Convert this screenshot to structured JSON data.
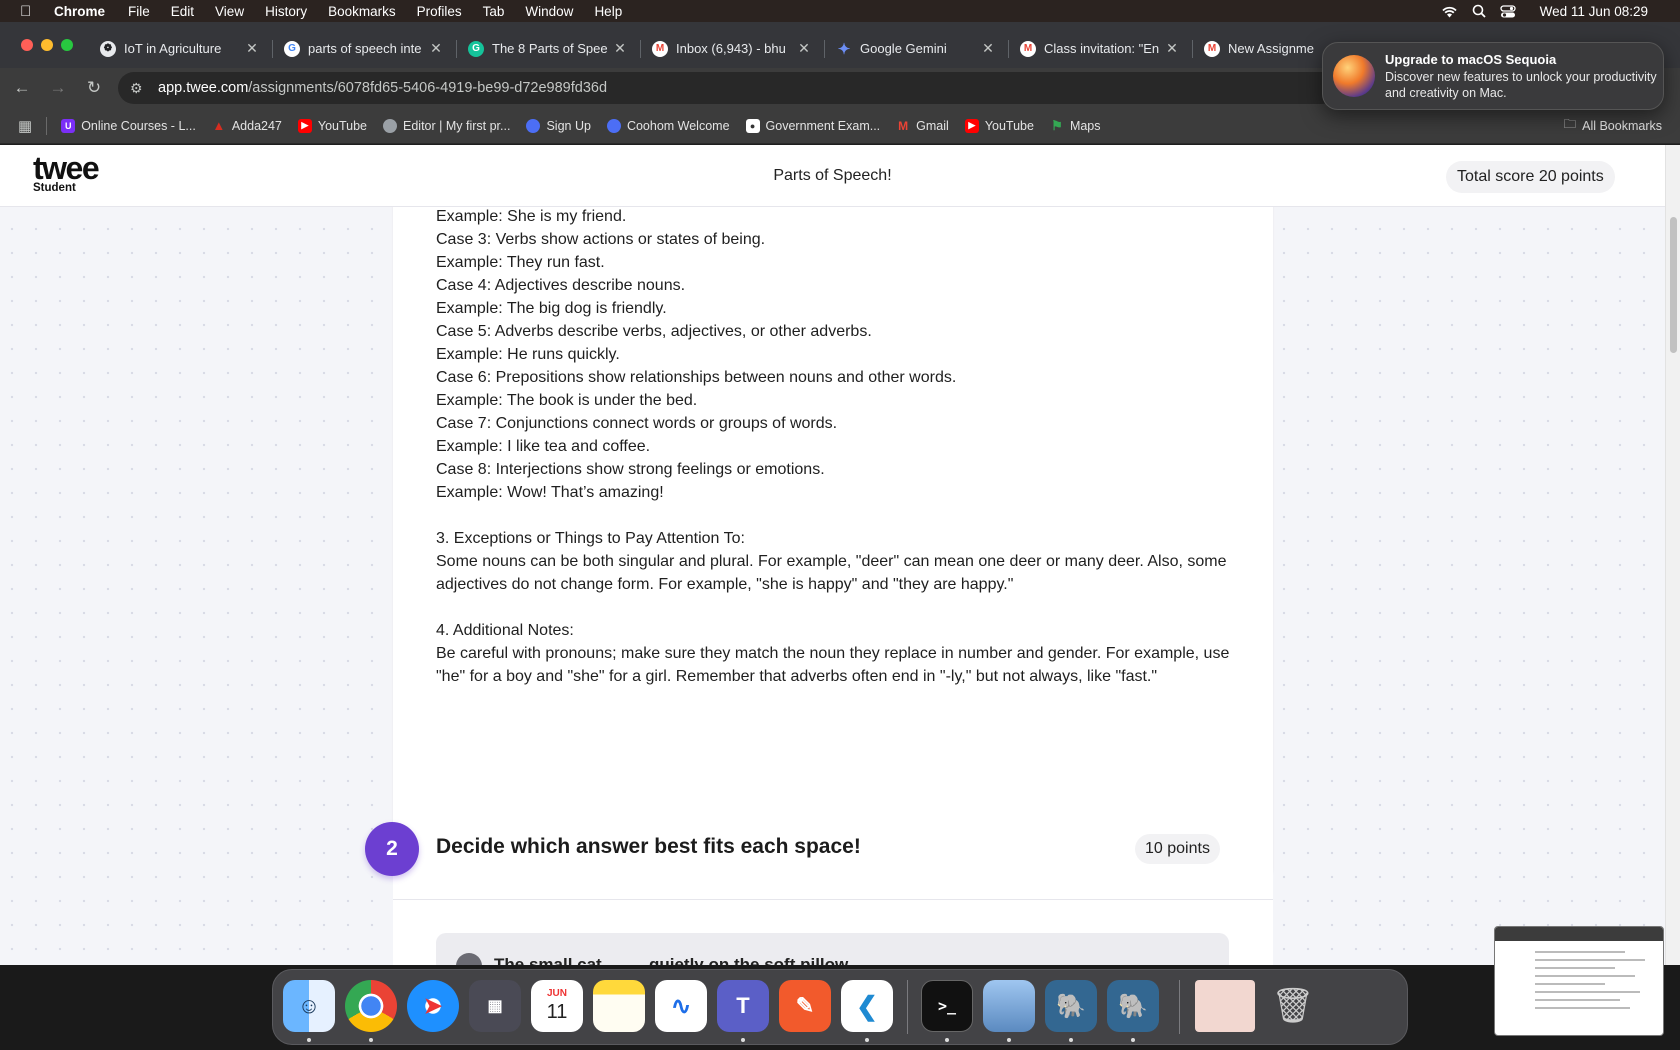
{
  "menubar": {
    "items": [
      "Chrome",
      "File",
      "Edit",
      "View",
      "History",
      "Bookmarks",
      "Profiles",
      "Tab",
      "Window",
      "Help"
    ],
    "clock": "Wed 11 Jun  08:29"
  },
  "tabs": [
    {
      "title": "IoT in Agriculture",
      "icon": "openai-icon",
      "color": "#e8eaed"
    },
    {
      "title": "parts of speech inte",
      "icon": "google-icon",
      "color": "#4285f4"
    },
    {
      "title": "The 8 Parts of Spee",
      "icon": "grammarly-icon",
      "color": "#15c39a"
    },
    {
      "title": "Inbox (6,943) - bhu",
      "icon": "gmail-icon",
      "color": "#ea4335"
    },
    {
      "title": "Google Gemini",
      "icon": "gemini-icon",
      "color": "#6c8ef5"
    },
    {
      "title": "Class invitation: \"En",
      "icon": "gmail-icon",
      "color": "#ea4335"
    },
    {
      "title": "New Assignme",
      "icon": "gmail-icon",
      "color": "#ea4335"
    }
  ],
  "address": {
    "host": "app.twee.com",
    "path": "/assignments/6078fd65-5406-4919-be99-d72e989fd36d"
  },
  "bookmarks": {
    "items": [
      {
        "label": "Online Courses - L...",
        "color": "#7b2ff7"
      },
      {
        "label": "Adda247",
        "color": "#d62d20"
      },
      {
        "label": "YouTube",
        "color": "#ff0000"
      },
      {
        "label": "Editor | My first pr...",
        "color": "#9aa0a6"
      },
      {
        "label": "Sign Up",
        "color": "#4c6ef5"
      },
      {
        "label": "Coohom Welcome",
        "color": "#4c6ef5"
      },
      {
        "label": "Government Exam...",
        "color": "#ffffff"
      },
      {
        "label": "Gmail",
        "color": "#ea4335"
      },
      {
        "label": "YouTube",
        "color": "#ff0000"
      },
      {
        "label": "Maps",
        "color": "#34a853"
      }
    ],
    "all_label": "All Bookmarks"
  },
  "notification": {
    "title": "Upgrade to macOS Sequoia",
    "body": "Discover new features to unlock your productivity and creativity on Mac."
  },
  "twee": {
    "logo": "twee",
    "role": "Student",
    "assignment_title": "Parts of Speech!",
    "total_score": "Total score 20 points"
  },
  "lesson": {
    "lines": [
      "Example: She is my friend.",
      "Case 3: Verbs show actions or states of being.",
      "Example: They run fast.",
      "Case 4: Adjectives describe nouns.",
      "Example: The big dog is friendly.",
      "Case 5: Adverbs describe verbs, adjectives, or other adverbs.",
      "Example: He runs quickly.",
      "Case 6: Prepositions show relationships between nouns and other words.",
      "Example: The book is under the bed.",
      "Case 7: Conjunctions connect words or groups of words.",
      "Example: I like tea and coffee.",
      "Case 8: Interjections show strong feelings or emotions.",
      "Example: Wow! That’s amazing!"
    ],
    "section3_heading": "3. Exceptions or Things to Pay Attention To:",
    "section3_body": "Some nouns can be both singular and plural. For example, \"deer\" can mean one deer or many deer. Also, some adjectives do not change form. For example, \"she is happy\" and \"they are happy.\"",
    "section4_heading": "4. Additional Notes:",
    "section4_body": "Be careful with pronouns; make sure they match the noun they replace in number and gender. For example, use \"he\" for a boy and \"she\" for a girl. Remember that adverbs often end in \"-ly,\" but not always, like \"fast.\""
  },
  "question2": {
    "number": "2",
    "title": "Decide which answer best fits each space!",
    "points": "10 points",
    "first_item": "The small cat ____ quietly on the soft pillow."
  },
  "dock": {
    "apps": [
      "Finder",
      "Chrome",
      "Safari",
      "Launchpad",
      "Calendar",
      "Notes",
      "Freeform",
      "Teams",
      "Sketch",
      "VS Code",
      "Terminal",
      "Preview",
      "PostgreSQL",
      "PostgreSQL"
    ],
    "calendar_month": "JUN",
    "calendar_day": "11"
  }
}
